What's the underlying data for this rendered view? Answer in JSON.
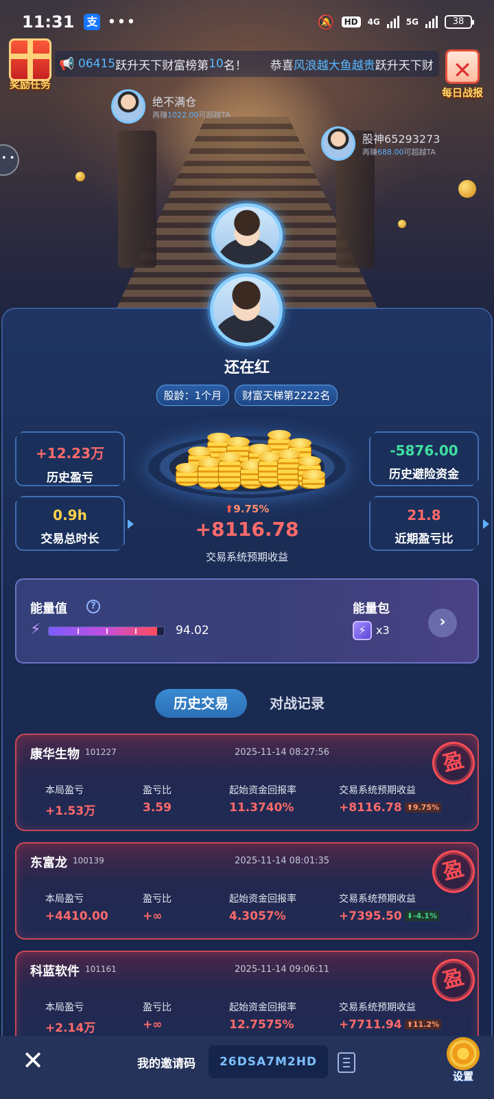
{
  "status_bar": {
    "time": "11:31",
    "alipay_glyph": "支",
    "hd_label": "HD",
    "net1": "4G",
    "net2": "5G",
    "battery": "38"
  },
  "ticker": {
    "items": [
      {
        "hl": "06415",
        "txt": "跃升天下财富榜第",
        "hl2": "10",
        "txt2": "名！"
      },
      {
        "txt": "恭喜",
        "hl": "风浪越大鱼越贵",
        "txt2": "跃升天下财"
      }
    ]
  },
  "side_buttons": {
    "reward_label": "奖励任务",
    "daily_label": "每日战报"
  },
  "rivals": [
    {
      "name": "绝不满仓",
      "pre": "再赚",
      "amount": "1022.00",
      "post": "可超越TA"
    },
    {
      "name": "股神65293273",
      "pre": "再赚",
      "amount": "688.00",
      "post": "可超越TA"
    }
  ],
  "profile": {
    "username": "还在红",
    "tags": [
      "股龄：1个月",
      "财富天梯第2222名"
    ]
  },
  "stats": {
    "hist_pnl": {
      "value": "+12.23万",
      "label": "历史盈亏"
    },
    "hedge": {
      "value": "-5876.00",
      "label": "历史避险资金"
    },
    "duration": {
      "value": "0.9h",
      "label": "交易总时长"
    },
    "ratio": {
      "value": "21.8",
      "label": "近期盈亏比"
    }
  },
  "expected": {
    "pct": "9.75%",
    "value": "+8116.78",
    "label": "交易系统预期收益"
  },
  "energy": {
    "title": "能量值",
    "help": "?",
    "value": "94.02",
    "fill_percent": 94.02,
    "pack_title": "能量包",
    "pack_count": "x3"
  },
  "tabs": {
    "active": "历史交易",
    "other": "对战记录"
  },
  "trade_labels": {
    "pnl": "本局盈亏",
    "ratio": "盈亏比",
    "roi": "起始资金回报率",
    "expected": "交易系统预期收益",
    "stamp": "盈"
  },
  "trades": [
    {
      "name": "康华生物",
      "code": "101227",
      "datetime": "2025-11-14 08:27:56",
      "pnl": "+1.53万",
      "ratio": "3.59",
      "roi": "11.3740%",
      "expected": "+8116.78",
      "delta": "9.75%",
      "delta_dir": "up"
    },
    {
      "name": "东富龙",
      "code": "100139",
      "datetime": "2025-11-14 08:01:35",
      "pnl": "+4410.00",
      "ratio": "+∞",
      "roi": "4.3057%",
      "expected": "+7395.50",
      "delta": "-4.1%",
      "delta_dir": "down"
    },
    {
      "name": "科蓝软件",
      "code": "101161",
      "datetime": "2025-11-14 09:06:11",
      "pnl": "+2.14万",
      "ratio": "+∞",
      "roi": "12.7575%",
      "expected": "+7711.94",
      "delta": "11.2%",
      "delta_dir": "up"
    }
  ],
  "bottom": {
    "invite_label": "我的邀请码",
    "invite_code": "26DSA7M2HD",
    "settings_label": "设置"
  },
  "colors": {
    "profit_red": "#ff6a6a",
    "loss_green": "#3fe0a0",
    "accent_blue": "#3a8ad2",
    "highlight_yellow": "#ffd24a"
  }
}
